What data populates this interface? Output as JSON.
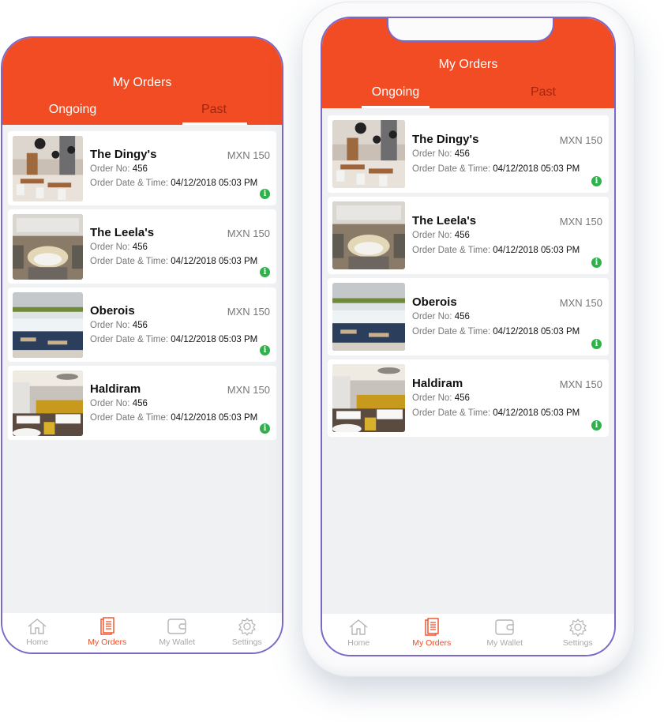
{
  "screen": {
    "title": "My Orders",
    "tabs": [
      {
        "label": "Ongoing"
      },
      {
        "label": "Past"
      }
    ]
  },
  "left_phone": {
    "active_tab": "Past"
  },
  "right_phone": {
    "active_tab": "Ongoing"
  },
  "orders": [
    {
      "name": "The Dingy's",
      "price": "MXN 150",
      "order_no_label": "Order No:",
      "order_no": "456",
      "date_label": "Order Date & Time:",
      "date": "04/12/2018  05:03 PM",
      "info_icon": "info-icon"
    },
    {
      "name": "The Leela's",
      "price": "MXN 150",
      "order_no_label": "Order No:",
      "order_no": "456",
      "date_label": "Order Date & Time:",
      "date": "04/12/2018  05:03 PM",
      "info_icon": "info-icon"
    },
    {
      "name": "Oberois",
      "price": "MXN 150",
      "order_no_label": "Order No:",
      "order_no": "456",
      "date_label": "Order Date & Time:",
      "date": "04/12/2018  05:03 PM",
      "info_icon": "info-icon"
    },
    {
      "name": "Haldiram",
      "price": "MXN 150",
      "order_no_label": "Order No:",
      "order_no": "456",
      "date_label": "Order Date & Time:",
      "date": "04/12/2018  05:03 PM",
      "info_icon": "info-icon"
    }
  ],
  "info_glyph": "i",
  "tabbar": [
    {
      "label": "Home",
      "icon": "home-icon"
    },
    {
      "label": "My Orders",
      "icon": "orders-icon",
      "active": true
    },
    {
      "label": "My Wallet",
      "icon": "wallet-icon"
    },
    {
      "label": "Settings",
      "icon": "gear-icon"
    }
  ],
  "colors": {
    "accent": "#f14c24",
    "inactive_tab": "#a5260c",
    "info_green": "#2db34a",
    "frame_outline": "#7b68c8",
    "background": "#f0f1f3"
  }
}
